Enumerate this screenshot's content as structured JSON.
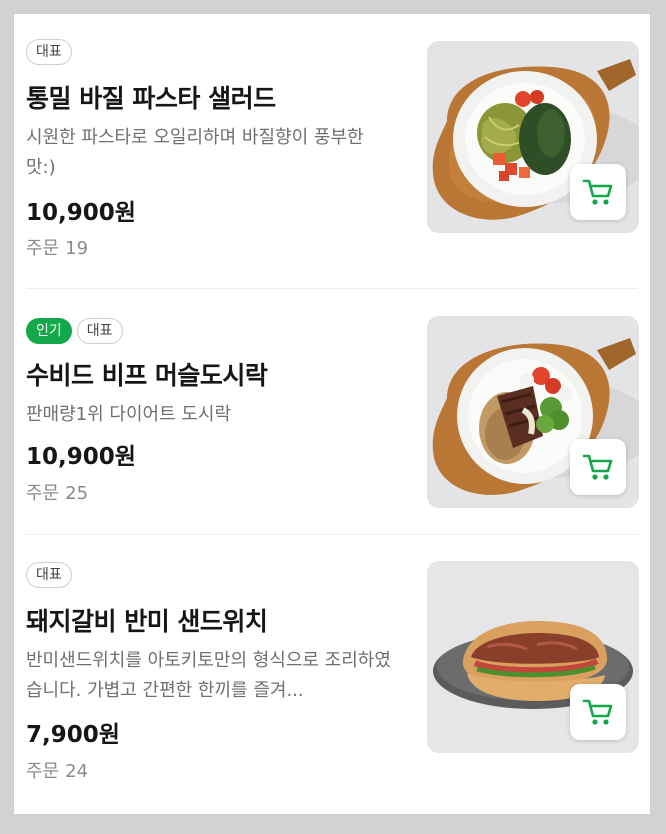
{
  "accent_color": "#13a84a",
  "items": [
    {
      "badges": [
        {
          "label": "대표",
          "style": "outline"
        }
      ],
      "name": "통밀 바질 파스타 샐러드",
      "description": "시원한 파스타로 오일리하며 바질향이 풍부한 맛:)",
      "price": "10,900원",
      "order_label": "주문",
      "order_count": "19",
      "image": "basil-pasta-salad-photo",
      "cart_icon": "cart-icon"
    },
    {
      "badges": [
        {
          "label": "인기",
          "style": "green"
        },
        {
          "label": "대표",
          "style": "outline"
        }
      ],
      "name": "수비드 비프 머슬도시락",
      "description": "판매량1위 다이어트 도시락",
      "price": "10,900원",
      "order_label": "주문",
      "order_count": "25",
      "image": "sous-vide-beef-bowl-photo",
      "cart_icon": "cart-icon"
    },
    {
      "badges": [
        {
          "label": "대표",
          "style": "outline"
        }
      ],
      "name": "돼지갈비 반미 샌드위치",
      "description": "반미샌드위치를 아토키토만의 형식으로 조리하였습니다. 가볍고 간편한 한끼를 즐겨...",
      "price": "7,900원",
      "order_label": "주문",
      "order_count": "24",
      "image": "pork-banh-mi-sandwich-photo",
      "cart_icon": "cart-icon"
    }
  ]
}
